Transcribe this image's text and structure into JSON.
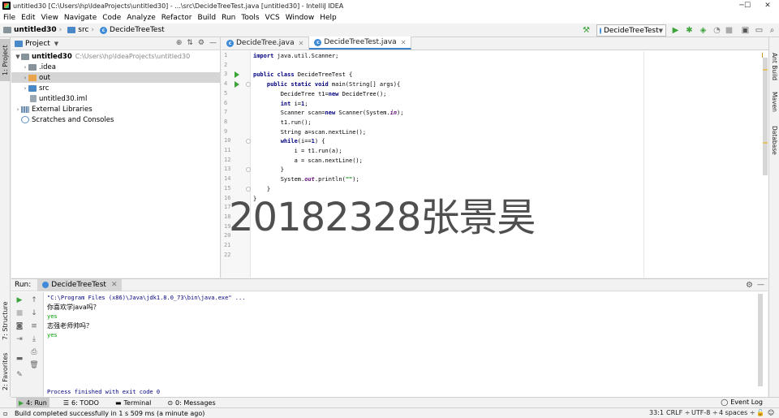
{
  "window": {
    "title": "untitled30 [C:\\Users\\hp\\IdeaProjects\\untitled30] - ...\\src\\DecideTreeTest.java [untitled30] - IntelliJ IDEA",
    "minimize": "─",
    "maximize": "☐",
    "close": "✕"
  },
  "menu": [
    "File",
    "Edit",
    "View",
    "Navigate",
    "Code",
    "Analyze",
    "Refactor",
    "Build",
    "Run",
    "Tools",
    "VCS",
    "Window",
    "Help"
  ],
  "navbar": {
    "project": "untitled30",
    "folder": "src",
    "file": "DecideTreeTest"
  },
  "run_config": "DecideTreeTest",
  "left_stripe": {
    "project": "1: Project",
    "structure": "7: Structure",
    "favorites": "2: Favorites"
  },
  "right_stripe": {
    "ant": "Ant Build",
    "maven": "Maven",
    "database": "Database"
  },
  "project_panel": {
    "title": "Project",
    "tree": [
      {
        "label": "untitled30",
        "path": "C:\\Users\\hp\\IdeaProjects\\untitled30"
      },
      {
        "label": ".idea"
      },
      {
        "label": "out"
      },
      {
        "label": "src"
      },
      {
        "label": "untitled30.iml"
      },
      {
        "label": "External Libraries"
      },
      {
        "label": "Scratches and Consoles"
      }
    ]
  },
  "editor": {
    "tabs": [
      "DecideTree.java",
      "DecideTreeTest.java"
    ],
    "line_numbers": [
      "1",
      "2",
      "3",
      "4",
      "5",
      "6",
      "7",
      "8",
      "9",
      "10",
      "11",
      "12",
      "13",
      "14",
      "15",
      "16",
      "17",
      "18",
      "19",
      "20",
      "21",
      "22"
    ],
    "code": [
      {
        "kw": "import",
        "rest": " java.util.Scanner;"
      },
      {
        "kw": "",
        "rest": ""
      },
      {
        "kw": "public class",
        "rest": " DecideTreeTest {"
      },
      {
        "indent": "    ",
        "kw": "public static void",
        "rest": " main(String[] args){"
      },
      {
        "indent": "        ",
        "kw": "",
        "rest": "DecideTree t1=",
        "kw2": "new",
        "rest2": " DecideTree();"
      },
      {
        "indent": "        ",
        "kw": "int",
        "rest": " i=",
        "num": "1",
        "rest2": ";"
      },
      {
        "indent": "        ",
        "kw": "",
        "rest": "Scanner scan=",
        "kw2": "new",
        "rest2": " Scanner(System.",
        "fld": "in",
        "rest3": ");"
      },
      {
        "indent": "        ",
        "kw": "",
        "rest": "t1.run();"
      },
      {
        "indent": "        ",
        "kw": "",
        "rest": "String a=scan.nextLine();"
      },
      {
        "indent": "        ",
        "kw": "while",
        "rest": "(i==",
        "num": "1",
        "rest2": ") {"
      },
      {
        "indent": "            ",
        "kw": "",
        "rest": "i = t1.run(a);"
      },
      {
        "indent": "            ",
        "kw": "",
        "rest": "a = scan.nextLine();"
      },
      {
        "indent": "        ",
        "kw": "",
        "rest": "}"
      },
      {
        "indent": "        ",
        "kw": "",
        "rest": "System.",
        "fld": "out",
        "rest3": ".println(",
        "str": "\"\"",
        "rest4": ");"
      },
      {
        "indent": "    ",
        "kw": "",
        "rest": "}"
      },
      {
        "kw": "",
        "rest": "}"
      }
    ]
  },
  "run_panel": {
    "label": "Run:",
    "tab": "DecideTreeTest",
    "console": {
      "cmd": "\"C:\\Program Files (x86)\\Java\\jdk1.8.0_73\\bin\\java.exe\" ...",
      "q1": "你喜欢学java吗？",
      "a1": "yes",
      "q2": "志强老师帅吗？",
      "a2": "yes",
      "finish": "Process finished with exit code 0"
    }
  },
  "bottom_tabs": {
    "run": "4: Run",
    "todo": "6: TODO",
    "terminal": "Terminal",
    "messages": "0: Messages",
    "event_log": "Event Log"
  },
  "status": {
    "message": "Build completed successfully in 1 s 509 ms (a minute ago)",
    "position": "33:1",
    "line_sep": "CRLF ÷",
    "encoding": "UTF-8 ÷",
    "indent": "4 spaces ÷"
  },
  "watermark": "20182328张景昊",
  "colors": {
    "keyword": "#000080",
    "string": "#008000",
    "field": "#660e7a",
    "run_green": "#3aa33a",
    "selection": "#d5d5d5"
  }
}
